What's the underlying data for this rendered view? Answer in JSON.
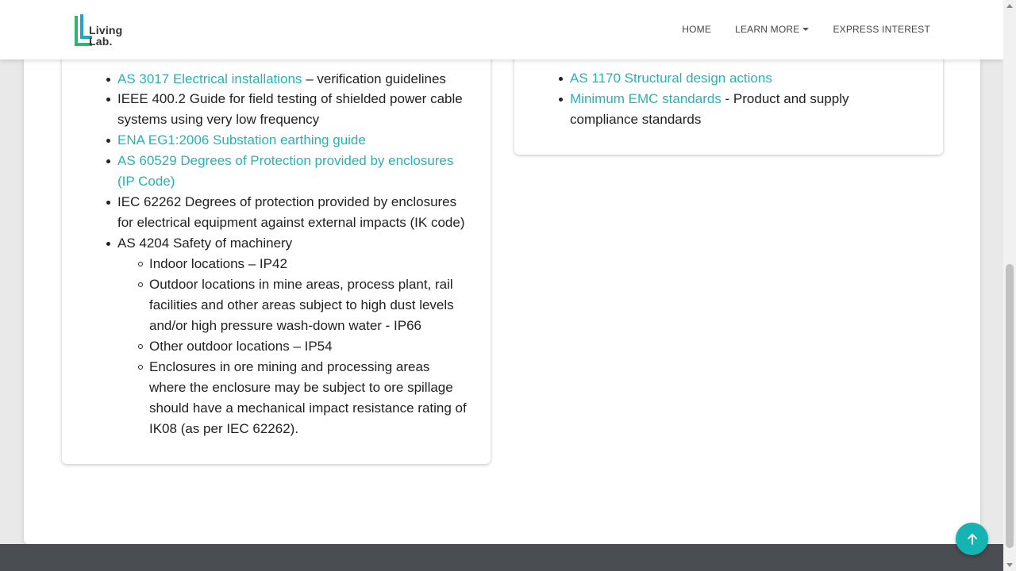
{
  "brand": {
    "line1": "Living",
    "line2": "Lab."
  },
  "nav": {
    "home": "HOME",
    "learn_more": "LEARN MORE",
    "express_interest": "EXPRESS INTEREST"
  },
  "left_card": {
    "items": [
      {
        "link": "AS 3017 Electrical installations",
        "text": " – verification guidelines"
      },
      {
        "text": "IEEE 400.2 Guide for field testing of shielded power cable systems using very low frequency"
      },
      {
        "link": "ENA EG1:2006 Substation earthing guide"
      },
      {
        "link": "AS 60529 Degrees of Protection provided by enclosures (IP Code)"
      },
      {
        "text": "IEC 62262 Degrees of protection provided by enclosures for electrical equipment against external impacts (IK code)"
      },
      {
        "text": "AS 4204 Safety of machinery"
      }
    ],
    "sub_items": [
      "Indoor locations – IP42",
      "Outdoor locations in mine areas, process plant, rail facilities and other areas subject to high dust levels and/or high pressure wash-down water - IP66",
      "Other outdoor locations – IP54",
      "Enclosures in ore mining and processing areas where the enclosure may be subject to ore spillage should have a mechanical impact resistance rating of IK08 (as per IEC 62262)."
    ]
  },
  "right_card": {
    "items": [
      {
        "link": "AS 1170 Structural design actions"
      },
      {
        "link": "Minimum EMC standards",
        "text": " - Product and supply compliance standards"
      }
    ]
  },
  "colors": {
    "accent": "#26b3b3",
    "button": "#16b3b3",
    "footer": "#4a4d52"
  },
  "icons": {
    "back_to_top": "arrow-up-icon",
    "dropdown": "caret-down-icon"
  }
}
